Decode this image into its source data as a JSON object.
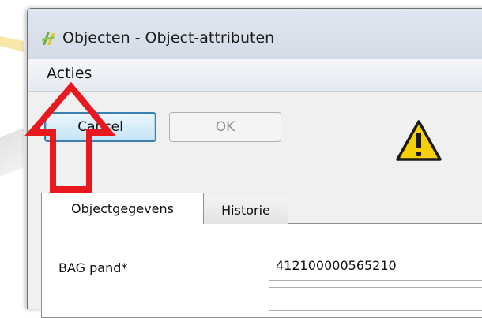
{
  "window": {
    "title": "Objecten - Object-attributen",
    "icon": "qgis-logo-icon"
  },
  "menu": {
    "acties_label": "Acties"
  },
  "buttons": {
    "cancel_label": "Cancel",
    "ok_label": "OK",
    "ok_enabled": false
  },
  "warning": {
    "icon": "warning-icon"
  },
  "tabs": [
    {
      "label": "Objectgegevens",
      "active": true
    },
    {
      "label": "Historie",
      "active": false
    }
  ],
  "form": {
    "bag_pand_label": "BAG pand*",
    "bag_pand_value": "412100000565210"
  },
  "annotation": {
    "arrow_color": "#e8181f",
    "points_to": "Acties"
  }
}
